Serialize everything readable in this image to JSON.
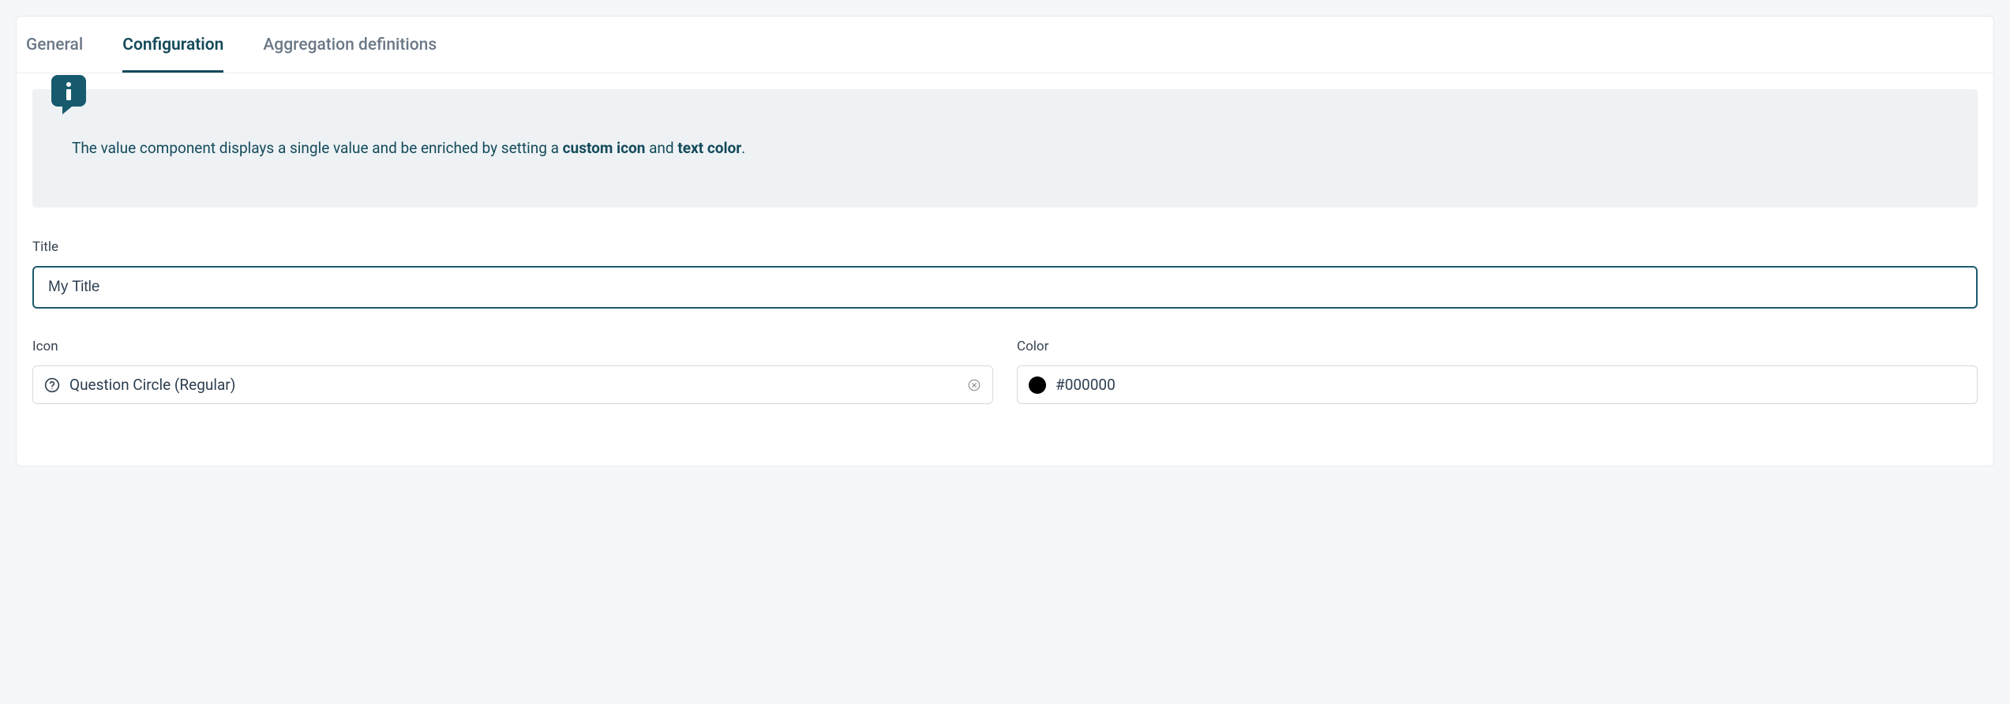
{
  "tabs": {
    "general": "General",
    "configuration": "Configuration",
    "aggregation": "Aggregation definitions"
  },
  "info": {
    "prefix": "The value component displays a single value and be enriched by setting a ",
    "bold1": "custom icon",
    "mid": " and ",
    "bold2": "text color",
    "suffix": "."
  },
  "fields": {
    "title_label": "Title",
    "title_value": "My Title",
    "icon_label": "Icon",
    "icon_value": "Question Circle (Regular)",
    "color_label": "Color",
    "color_value": "#000000"
  }
}
